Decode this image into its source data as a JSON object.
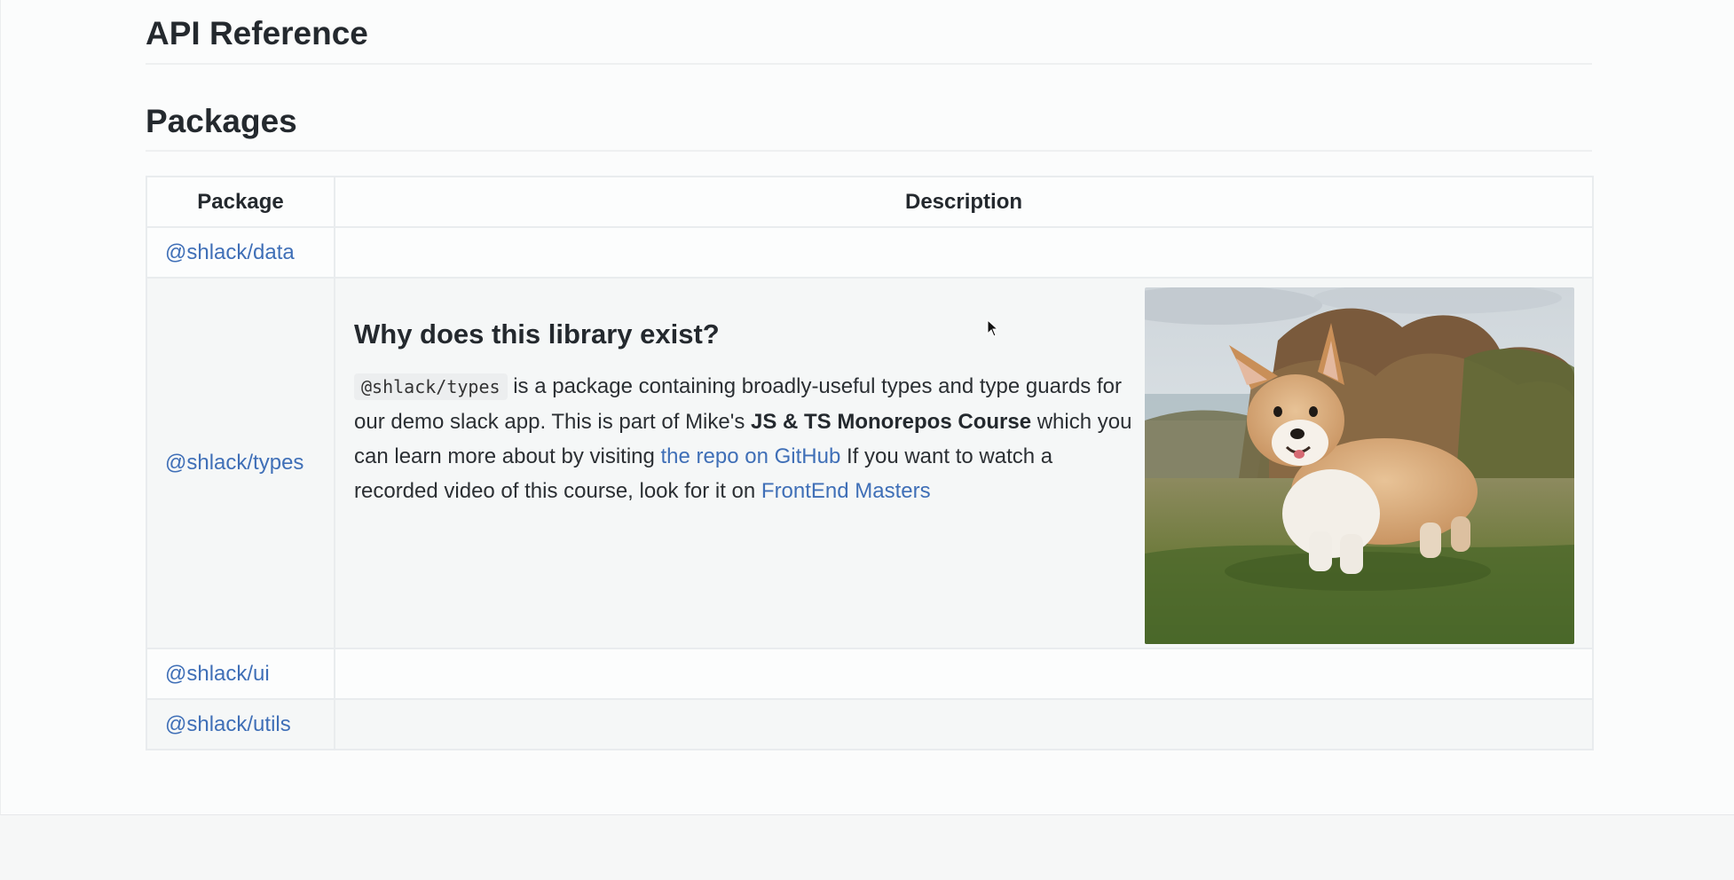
{
  "headings": {
    "api_reference": "API Reference",
    "packages": "Packages"
  },
  "table": {
    "headers": {
      "package": "Package",
      "description": "Description"
    },
    "rows": [
      {
        "package": "@shlack/data"
      },
      {
        "package": "@shlack/types"
      },
      {
        "package": "@shlack/ui"
      },
      {
        "package": "@shlack/utils"
      }
    ]
  },
  "types_description": {
    "heading": "Why does this library exist?",
    "code": "@shlack/types",
    "text_1": " is a package containing broadly-useful types and type guards for our demo slack app. This is part of Mike's ",
    "bold": "JS & TS Monorepos Course",
    "text_2": " which you can learn more about by visiting ",
    "link_repo": "the repo on GitHub",
    "text_3": " If you want to watch a recorded video of this course, look for it on ",
    "link_fem": "FrontEnd Masters"
  },
  "colors": {
    "link": "#3f6fb7",
    "text": "#24292e",
    "border": "#e9ecee"
  },
  "icons": {
    "cursor": "mouse-pointer-icon",
    "image": "corgi-photo"
  }
}
